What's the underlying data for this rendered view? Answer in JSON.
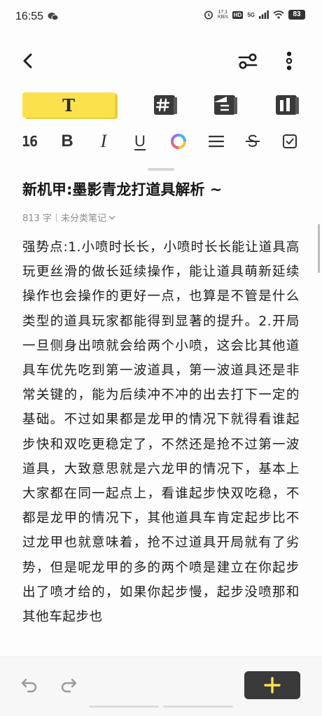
{
  "status": {
    "time": "16:55",
    "speed_top": "17.1",
    "speed_bottom": "KB/s",
    "hd": "HD",
    "network": "5G",
    "battery": "83"
  },
  "toolbar": {
    "back_icon": "chevron-left-icon",
    "settings_icon": "sliders-icon",
    "more_icon": "more-vertical-icon"
  },
  "format_tiles": {
    "text_label": "T",
    "items": [
      "text-style-icon",
      "hashtag-icon",
      "layout-icon",
      "columns-icon"
    ]
  },
  "style_bar": {
    "font_size": "16",
    "bold": "B",
    "italic": "I",
    "underline": "U"
  },
  "note": {
    "title": "新机甲:墨影青龙打道具解析 ~",
    "word_count": "813 字",
    "category": "未分类笔记",
    "body": "强势点:1.小喷时长长，小喷时长长能让道具高玩更丝滑的做长延续操作，能让道具萌新延续操作也会操作的更好一点，也算是不管是什么类型的道具玩家都能得到显著的提升。2.开局一旦侧身出喷就会给两个小喷，这会比其他道具车优先吃到第一波道具，第一波道具还是非常关键的，能为后续冲不冲的出去打下一定的基础。不过如果都是龙甲的情况下就得看谁起步快和双吃更稳定了，不然还是抢不过第一波道具，大致意思就是六龙甲的情况下，基本上大家都在同一起点上，看谁起步快双吃稳，不都是龙甲的情况下，其他道具车肯定起步比不过龙甲也就意味着，抢不过道具开局就有了劣势，但是呢龙甲的多的两个喷是建立在你起步出了喷才给的，如果你起步慢，起步没喷那和其他车起步也"
  },
  "colors": {
    "accent_yellow": "#fbe24d",
    "icon_dark": "#333333",
    "add_button": "#3a3a3a",
    "plus_yellow": "#fbe24d"
  }
}
